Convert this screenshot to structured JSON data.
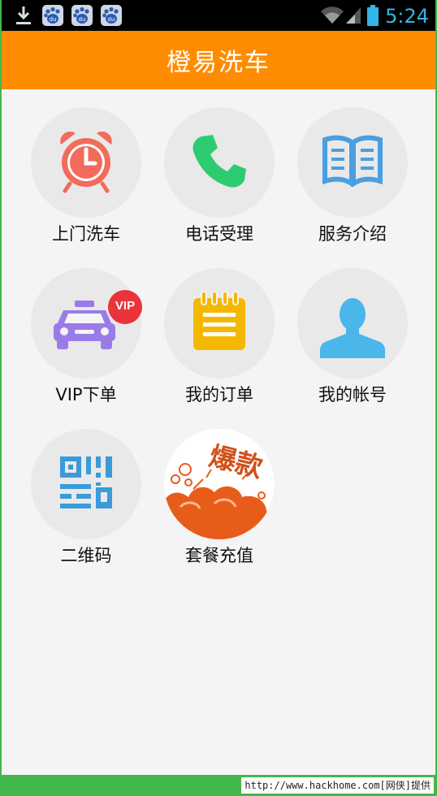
{
  "status_bar": {
    "time": "5:24",
    "icons": [
      "download-icon",
      "baidu-icon",
      "baidu-icon",
      "baidu-icon",
      "wifi-icon",
      "signal-icon",
      "battery-icon"
    ],
    "baidu_badge_text": "du"
  },
  "header": {
    "title": "橙易洗车"
  },
  "menu": {
    "items": [
      {
        "label": "上门洗车",
        "icon": "alarm-clock-icon"
      },
      {
        "label": "电话受理",
        "icon": "phone-icon"
      },
      {
        "label": "服务介绍",
        "icon": "book-icon"
      },
      {
        "label": "VIP下单",
        "icon": "vip-car-icon"
      },
      {
        "label": "我的订单",
        "icon": "notepad-icon"
      },
      {
        "label": "我的帐号",
        "icon": "user-icon"
      },
      {
        "label": "二维码",
        "icon": "qr-code-icon"
      },
      {
        "label": "套餐充值",
        "icon": "promo-explosion-icon"
      }
    ],
    "vip_badge": "VIP",
    "promo_badge": "爆款"
  },
  "footer": {
    "watermark": "http://www.hackhome.com[网侠]提供"
  },
  "colors": {
    "header": "#ff8c00",
    "status_accent": "#33b5e5",
    "frame": "#43b84a",
    "clock": "#f26b5b",
    "phone": "#2ecc71",
    "book": "#4a9fe0",
    "car": "#9b7be8",
    "notepad": "#f5b800",
    "user": "#4ab6ea",
    "qr": "#3a9bd8",
    "promo": "#e85c1a"
  }
}
